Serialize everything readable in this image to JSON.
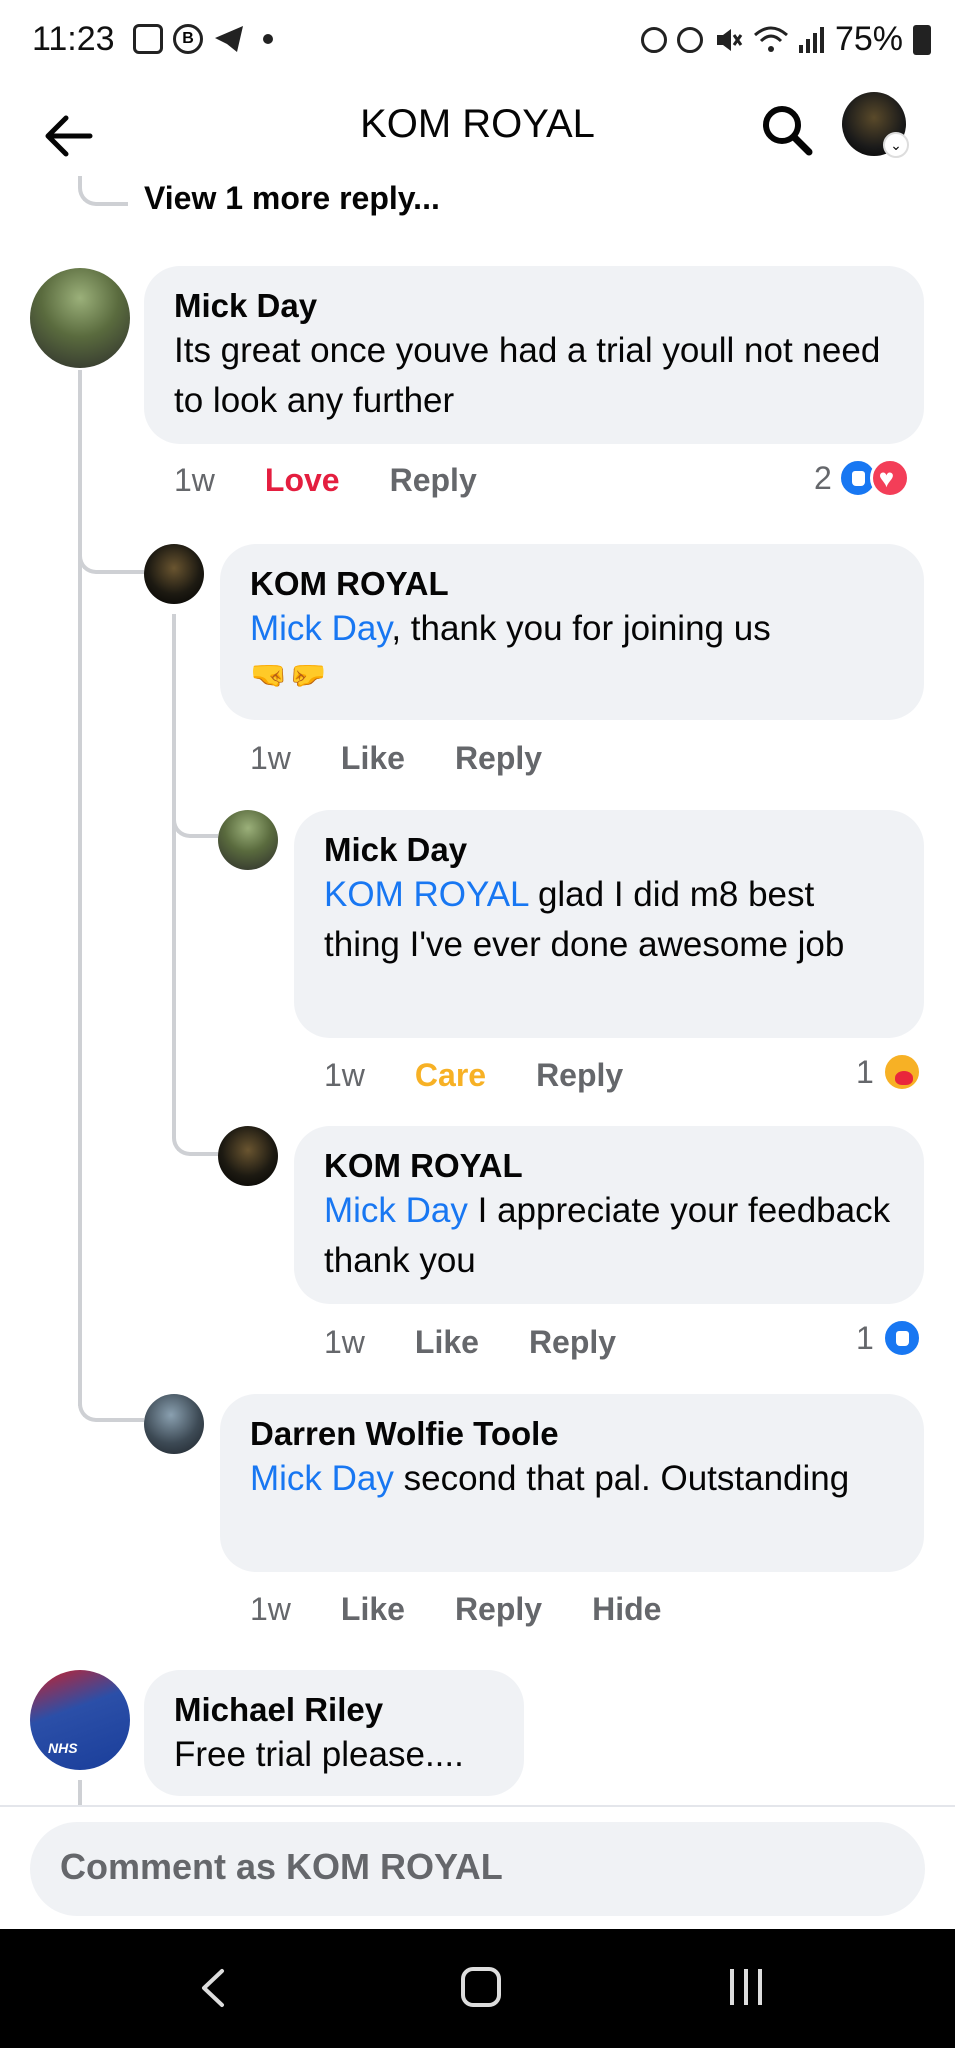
{
  "status_bar": {
    "time": "11:23",
    "battery": "75%"
  },
  "header": {
    "title": "KOM ROYAL"
  },
  "view_more": "View 1 more reply...",
  "comments": [
    {
      "name": "Mick Day",
      "text": "Its great once youve had a trial youll not need to look any further",
      "time": "1w",
      "reaction_label": "Love",
      "reply_label": "Reply",
      "reaction_count": "2"
    },
    {
      "name": "KOM ROYAL",
      "mention": "Mick Day",
      "text": ", thank you for joining us",
      "emoji": "🤜🤛",
      "time": "1w",
      "like_label": "Like",
      "reply_label": "Reply"
    },
    {
      "name": "Mick Day",
      "mention": "KOM ROYAL",
      "text": " glad I did m8 best thing I've ever done awesome job",
      "time": "1w",
      "reaction_label": "Care",
      "reply_label": "Reply",
      "reaction_count": "1"
    },
    {
      "name": "KOM ROYAL",
      "mention": "Mick Day",
      "text": " I appreciate your feedback thank you",
      "time": "1w",
      "like_label": "Like",
      "reply_label": "Reply",
      "reaction_count": "1"
    },
    {
      "name": "Darren Wolfie Toole",
      "mention": "Mick Day",
      "text": " second that pal. Outstanding",
      "time": "1w",
      "like_label": "Like",
      "reply_label": "Reply",
      "hide_label": "Hide"
    },
    {
      "name": "Michael Riley",
      "text": "Free trial please....",
      "avatar_badge": "NHS"
    }
  ],
  "comment_input": {
    "placeholder": "Comment as KOM ROYAL"
  },
  "colors": {
    "accent": "#1877f2",
    "love": "#e41e3f",
    "care": "#f7b125",
    "bubble": "#f0f2f5",
    "muted": "#65676b"
  }
}
